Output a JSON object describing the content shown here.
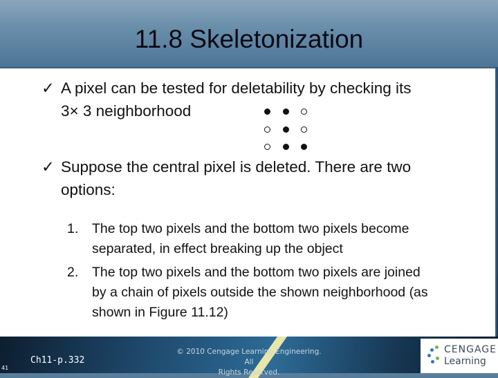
{
  "slide": {
    "title": "11.8 Skeletonization",
    "bullets": [
      {
        "lines": [
          "A pixel can be tested for deletability by checking its",
          "3× 3 neighborhood"
        ]
      },
      {
        "lines": [
          "Suppose the central pixel is deleted. There are two",
          "options:"
        ]
      }
    ],
    "check_icon": "✓",
    "numbered": [
      {
        "num": "1.",
        "lines": [
          "The top two pixels and the bottom two pixels become",
          "separated, in effect breaking up the object"
        ]
      },
      {
        "num": "2.",
        "lines": [
          "The top two pixels and the bottom two pixels are joined",
          "by a chain of pixels outside the shown neighborhood (as",
          "shown in Figure 11.12)"
        ]
      }
    ],
    "neighborhood": [
      [
        1,
        1,
        0
      ],
      [
        0,
        1,
        0
      ],
      [
        0,
        1,
        1
      ]
    ]
  },
  "footer": {
    "page_number": "41",
    "chapter_ref": "Ch11-p.332",
    "copyright": [
      "© 2010 Cengage Learning Engineering. All",
      "Rights Reserved."
    ],
    "logo": [
      "CENGAGE",
      "Learning"
    ]
  }
}
